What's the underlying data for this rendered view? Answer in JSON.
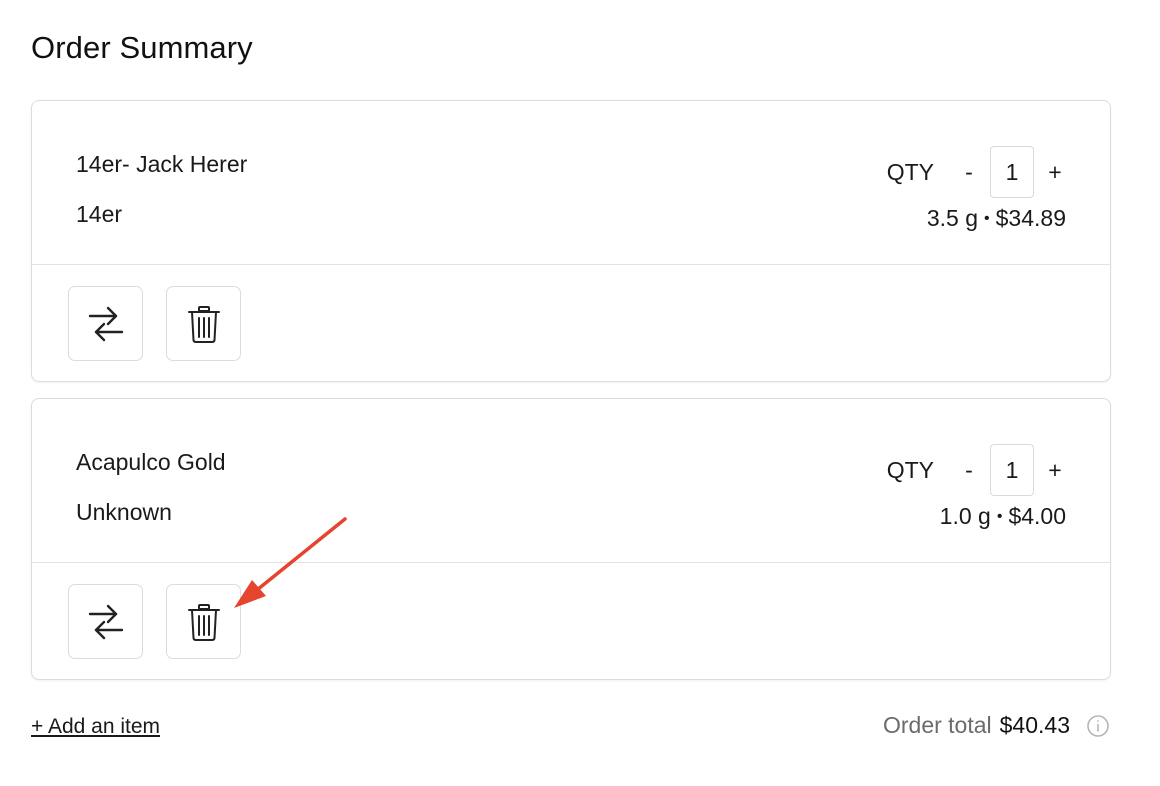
{
  "header": {
    "title": "Order Summary"
  },
  "items": [
    {
      "name": "14er- Jack Herer",
      "brand": "14er",
      "qty_label": "QTY",
      "minus": "-",
      "plus": "+",
      "quantity": "1",
      "weight": "3.5 g",
      "separator": "•",
      "price": "$34.89",
      "swap_icon": "swap-arrows-icon",
      "delete_icon": "trash-icon"
    },
    {
      "name": "Acapulco Gold",
      "brand": "Unknown",
      "qty_label": "QTY",
      "minus": "-",
      "plus": "+",
      "quantity": "1",
      "weight": "1.0 g",
      "separator": "•",
      "price": "$4.00",
      "swap_icon": "swap-arrows-icon",
      "delete_icon": "trash-icon"
    }
  ],
  "footer": {
    "add_item": "+ Add an item",
    "total_label": "Order total",
    "total_value": "$40.43",
    "info_icon": "info-icon"
  },
  "colors": {
    "annotation_arrow": "#e5442f",
    "border": "#dcdcdc",
    "muted_text": "#6b6b6b"
  }
}
